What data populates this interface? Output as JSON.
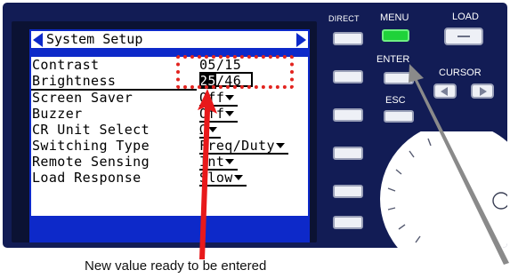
{
  "screen": {
    "title": "System Setup",
    "left_arrow_icon": "left-triangle-icon",
    "right_arrow_icon": "right-triangle-icon",
    "items": [
      {
        "label": "Contrast",
        "value": "05/15"
      },
      {
        "label": "Brightness",
        "value_highlight": "25",
        "value_rest": "/46"
      },
      {
        "label": "Screen Saver",
        "value": "Off",
        "dropdown": true
      },
      {
        "label": "Buzzer",
        "value": "Off",
        "dropdown": true
      },
      {
        "label": "CR Unit Select",
        "value": "Ω",
        "dropdown": true
      },
      {
        "label": "Switching Type",
        "value": "Freq/Duty",
        "dropdown": true
      },
      {
        "label": "Remote Sensing",
        "value": "Int",
        "dropdown": true
      },
      {
        "label": "Load Response",
        "value": "Slow",
        "dropdown": true
      }
    ]
  },
  "panel": {
    "direct_label": "DIRECT",
    "menu_label": "MENU",
    "load_label": "LOAD",
    "enter_label": "ENTER",
    "cursor_label": "CURSOR",
    "esc_label": "ESC",
    "menu_led_color": "#1fd23a"
  },
  "annotation": {
    "caption": "New value ready to be entered",
    "arrow_color": "#e8191b",
    "pointer_color": "#8a8a8a",
    "highlight_color": "#e2241f"
  }
}
